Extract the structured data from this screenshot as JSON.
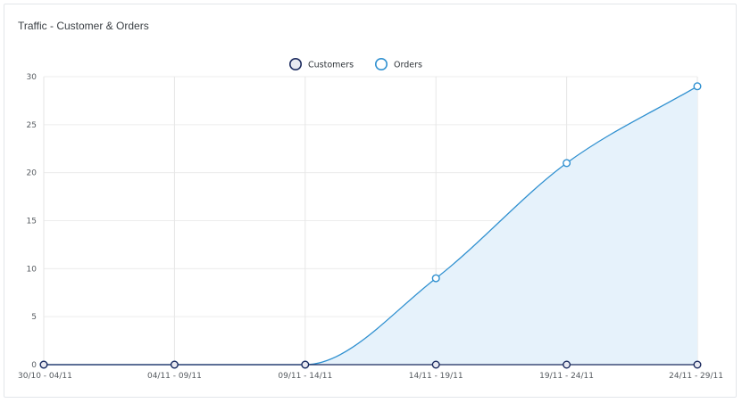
{
  "card": {
    "title": "Traffic - Customer & Orders"
  },
  "chart_data": {
    "type": "area",
    "title": "Traffic - Customer & Orders",
    "categories": [
      "30/10 - 04/11",
      "04/11 - 09/11",
      "09/11 - 14/11",
      "14/11 - 19/11",
      "19/11 - 24/11",
      "24/11 - 29/11"
    ],
    "ylim": [
      0,
      30
    ],
    "yticks": [
      0,
      5,
      10,
      15,
      20,
      25,
      30
    ],
    "grid": true,
    "legend_position": "top-center",
    "series": [
      {
        "name": "Customers",
        "values": [
          0,
          0,
          0,
          0,
          0,
          0
        ],
        "color": "#1b2a5e",
        "marker_fill": "#e8e9f1"
      },
      {
        "name": "Orders",
        "values": [
          0,
          0,
          0,
          9,
          21,
          29
        ],
        "color": "#2f90d0",
        "fill": "#e6f2fb",
        "marker_fill": "#ffffff"
      }
    ]
  }
}
